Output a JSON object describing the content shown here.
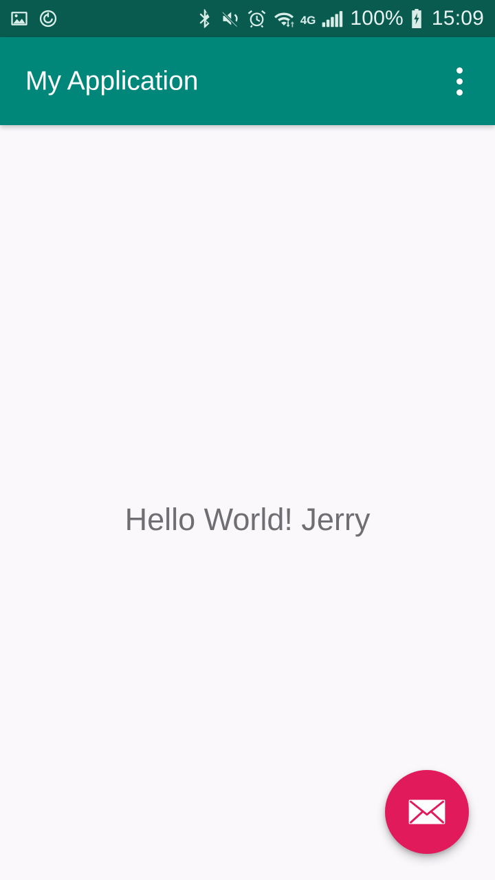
{
  "status_bar": {
    "background_color": "#0a5b4f",
    "left_icons": [
      {
        "name": "photo-image-icon",
        "label": "Screenshot saved"
      },
      {
        "name": "power-saving-icon",
        "label": "Power mode"
      }
    ],
    "right_icons": [
      {
        "name": "bluetooth-icon",
        "label": "Bluetooth"
      },
      {
        "name": "volume-mute-icon",
        "label": "Sound muted"
      },
      {
        "name": "alarm-clock-icon",
        "label": "Alarm set"
      },
      {
        "name": "wifi-icon",
        "label": "Wi-Fi connected"
      },
      {
        "name": "signal-bars-icon",
        "label": "Cellular signal"
      },
      {
        "name": "battery-charging-icon",
        "label": "Battery charging"
      }
    ],
    "network_type": "4G",
    "battery_percent": "100%",
    "time": "15:09"
  },
  "app_bar": {
    "title": "My Application",
    "background_color": "#008779",
    "title_color": "#ffffff",
    "overflow_menu": {
      "name": "overflow-menu",
      "label": "More options"
    }
  },
  "content": {
    "background_color": "#faf8fb",
    "hello_text": "Hello World! Jerry",
    "hello_text_color": "#6f6f73"
  },
  "fab": {
    "name": "email-fab",
    "label": "Compose email",
    "icon": "envelope-icon",
    "background_color": "#e01a5b",
    "icon_color": "#ffffff"
  }
}
